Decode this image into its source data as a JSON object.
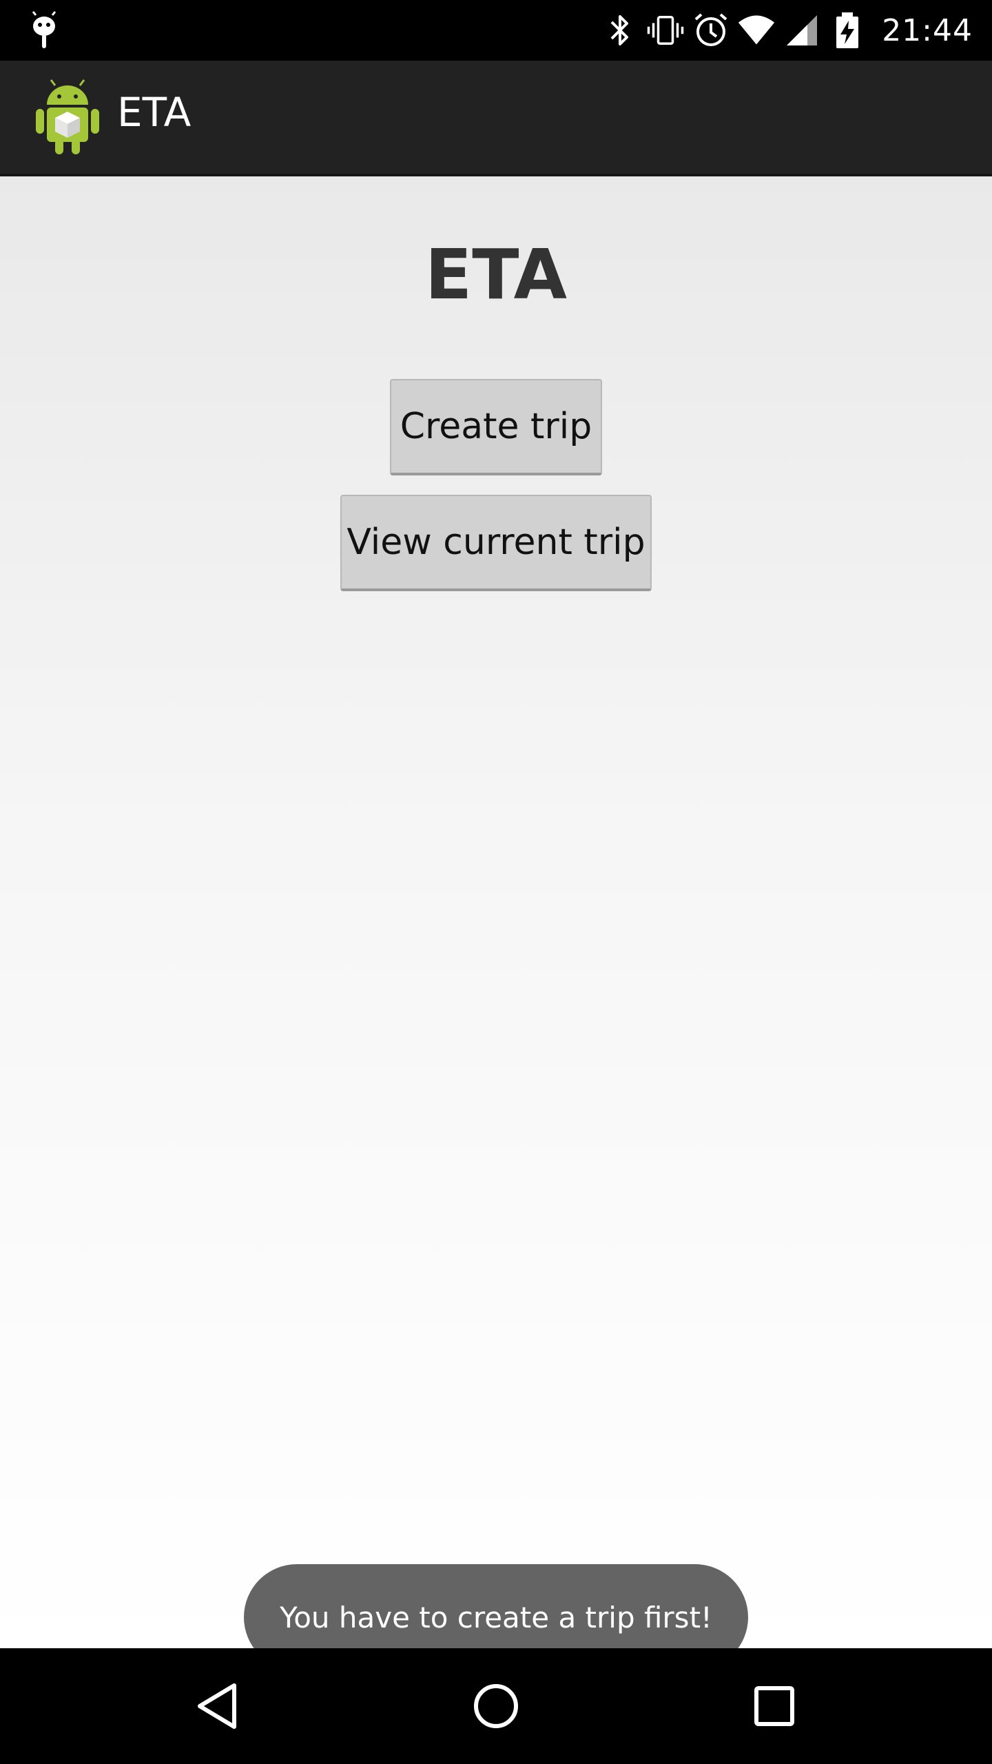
{
  "status_bar": {
    "time": "21:44",
    "icons": [
      "android-notification-icon",
      "bluetooth-icon",
      "vibrate-icon",
      "alarm-icon",
      "wifi-icon",
      "signal-icon",
      "battery-charging-icon"
    ]
  },
  "action_bar": {
    "title": "ETA",
    "logo": "android-app-icon"
  },
  "main": {
    "heading": "ETA",
    "buttons": {
      "create_trip": "Create trip",
      "view_current_trip": "View current trip"
    }
  },
  "toast": {
    "message": "You have to create a trip first!"
  },
  "nav_bar": {
    "buttons": [
      "back-icon",
      "home-icon",
      "recents-icon"
    ]
  },
  "colors": {
    "status_bar_bg": "#000000",
    "action_bar_bg": "#222222",
    "button_bg": "#d1d1d1",
    "toast_bg": "#646464",
    "android_green": "#a4c639"
  }
}
